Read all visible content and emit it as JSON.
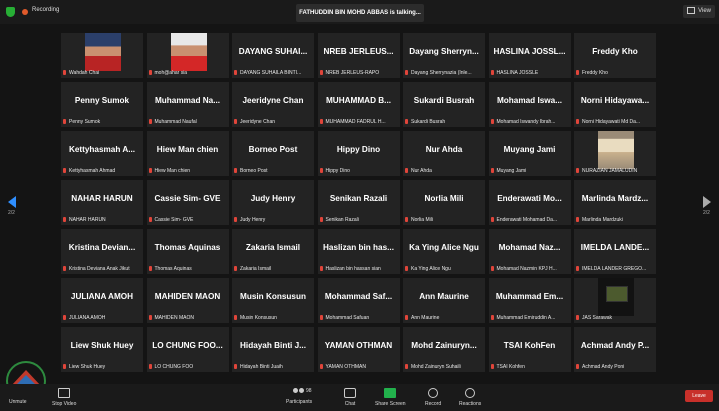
{
  "topbar": {
    "recording_label": "Recording",
    "talking_label": "FATHUDDIN BIN MOHD ABBAS is talking...",
    "view_label": "View"
  },
  "nav": {
    "left_page": "2/2",
    "right_page": "2/2"
  },
  "tiles": [
    {
      "big": "",
      "small": "Wahdah Chai",
      "photo": "p1"
    },
    {
      "big": "",
      "small": "moh@ahar sia",
      "photo": "p2"
    },
    {
      "big": "DAYANG SUHAI...",
      "small": "DAYANG SUHAILA BINTI...",
      "photo": ""
    },
    {
      "big": "NREB JERLEUS...",
      "small": "NREB JERLEUS-RAPO",
      "photo": ""
    },
    {
      "big": "Dayang Sherryn...",
      "small": "Dayang Sherrynazia (Inle...",
      "photo": ""
    },
    {
      "big": "HASLINA JOSSL...",
      "small": "HASLINA JOSSLE",
      "photo": ""
    },
    {
      "big": "Freddy Kho",
      "small": "Freddy Kho",
      "photo": ""
    },
    {
      "big": "Penny Sumok",
      "small": "Penny Sumok",
      "photo": ""
    },
    {
      "big": "Muhammad Na...",
      "small": "Muhammad Naufal",
      "photo": ""
    },
    {
      "big": "Jeeridyne Chan",
      "small": "Jeeridyne Chan",
      "photo": ""
    },
    {
      "big": "MUHAMMAD B...",
      "small": "MUHAMMAD FADRUL H...",
      "photo": ""
    },
    {
      "big": "Sukardi Busrah",
      "small": "Sukardi Busrah",
      "photo": ""
    },
    {
      "big": "Mohamad Iswa...",
      "small": "Mohamad Iswandy Ibrah...",
      "photo": ""
    },
    {
      "big": "Norni Hidayawa...",
      "small": "Norni Hidayawati Md Da...",
      "photo": ""
    },
    {
      "big": "Kettyhasmah A...",
      "small": "Kettyhasmah Ahmad",
      "photo": ""
    },
    {
      "big": "Hiew Man chien",
      "small": "Hiew Man chien",
      "photo": ""
    },
    {
      "big": "Borneo Post",
      "small": "Borneo Post",
      "photo": ""
    },
    {
      "big": "Hippy Dino",
      "small": "Hippy Dino",
      "photo": ""
    },
    {
      "big": "Nur Ahda",
      "small": "Nur Ahda",
      "photo": ""
    },
    {
      "big": "Muyang Jami",
      "small": "Muyang Jami",
      "photo": ""
    },
    {
      "big": "",
      "small": "NURAZIAN JAMALUDIN",
      "photo": "p3"
    },
    {
      "big": "NAHAR HARUN",
      "small": "NAHAR HARUN",
      "photo": ""
    },
    {
      "big": "Cassie Sim- GVE",
      "small": "Cassie Sim- GVE",
      "photo": ""
    },
    {
      "big": "Judy Henry",
      "small": "Judy Henry",
      "photo": ""
    },
    {
      "big": "Senikan Razali",
      "small": "Senikan Razali",
      "photo": ""
    },
    {
      "big": "Norlia Mili",
      "small": "Norlia Mili",
      "photo": ""
    },
    {
      "big": "Enderawati Mo...",
      "small": "Enderawati Mohamad Da...",
      "photo": ""
    },
    {
      "big": "Marlinda Mardz...",
      "small": "Marlinda Mardzuki",
      "photo": ""
    },
    {
      "big": "Kristina Devian...",
      "small": "Kristina Deviana Anak Jikut",
      "photo": ""
    },
    {
      "big": "Thomas Aquinas",
      "small": "Thomas Aquinas",
      "photo": ""
    },
    {
      "big": "Zakaria Ismail",
      "small": "Zakaria Ismail",
      "photo": ""
    },
    {
      "big": "Haslizan bin has...",
      "small": "Haslizan bin hassan sian",
      "photo": ""
    },
    {
      "big": "Ka Ying Alice Ngu",
      "small": "Ka Ying Alice Ngu",
      "photo": ""
    },
    {
      "big": "Mohamad Naz...",
      "small": "Mohamad Nazmin KPJ H...",
      "photo": ""
    },
    {
      "big": "IMELDA LANDE...",
      "small": "IMELDA LANDER GREGO...",
      "photo": ""
    },
    {
      "big": "JULIANA AMOH",
      "small": "JULIANA AMOH",
      "photo": ""
    },
    {
      "big": "MAHIDEN MAON",
      "small": "MAHIDEN MAON",
      "photo": ""
    },
    {
      "big": "Musin Konsusun",
      "small": "Musin Konsusun",
      "photo": ""
    },
    {
      "big": "Mohammad Saf...",
      "small": "Mohammad Safuan",
      "photo": ""
    },
    {
      "big": "Ann Maurine",
      "small": "Ann Maurine",
      "photo": ""
    },
    {
      "big": "Muhammad Em...",
      "small": "Muhammad Emiruddin A...",
      "photo": ""
    },
    {
      "big": "",
      "small": "JAS Sarawak",
      "photo": "p4"
    },
    {
      "big": "Liew Shuk Huey",
      "small": "Liew Shuk Huey",
      "photo": ""
    },
    {
      "big": "LO CHUNG FOO...",
      "small": "LO CHUNG FOO",
      "photo": ""
    },
    {
      "big": "Hidayah Binti J...",
      "small": "Hidayah Binti Juaih",
      "photo": ""
    },
    {
      "big": "YAMAN OTHMAN",
      "small": "YAMAN OTHMAN",
      "photo": ""
    },
    {
      "big": "Mohd Zainuryn...",
      "small": "Mohd Zainuryn Suhaili",
      "photo": ""
    },
    {
      "big": "TSAI KohFen",
      "small": "TSAI Kohfen",
      "photo": ""
    },
    {
      "big": "Achmad Andy P...",
      "small": "Achmad Andy Poni",
      "photo": ""
    }
  ],
  "bottombar": {
    "unmute_label": "Unmute",
    "stop_video_label": "Stop Video",
    "participants_label": "Participants",
    "participants_count": "98",
    "chat_label": "Chat",
    "share_screen_label": "Share Screen",
    "record_label": "Record",
    "reactions_label": "Reactions",
    "leave_label": "Leave"
  }
}
